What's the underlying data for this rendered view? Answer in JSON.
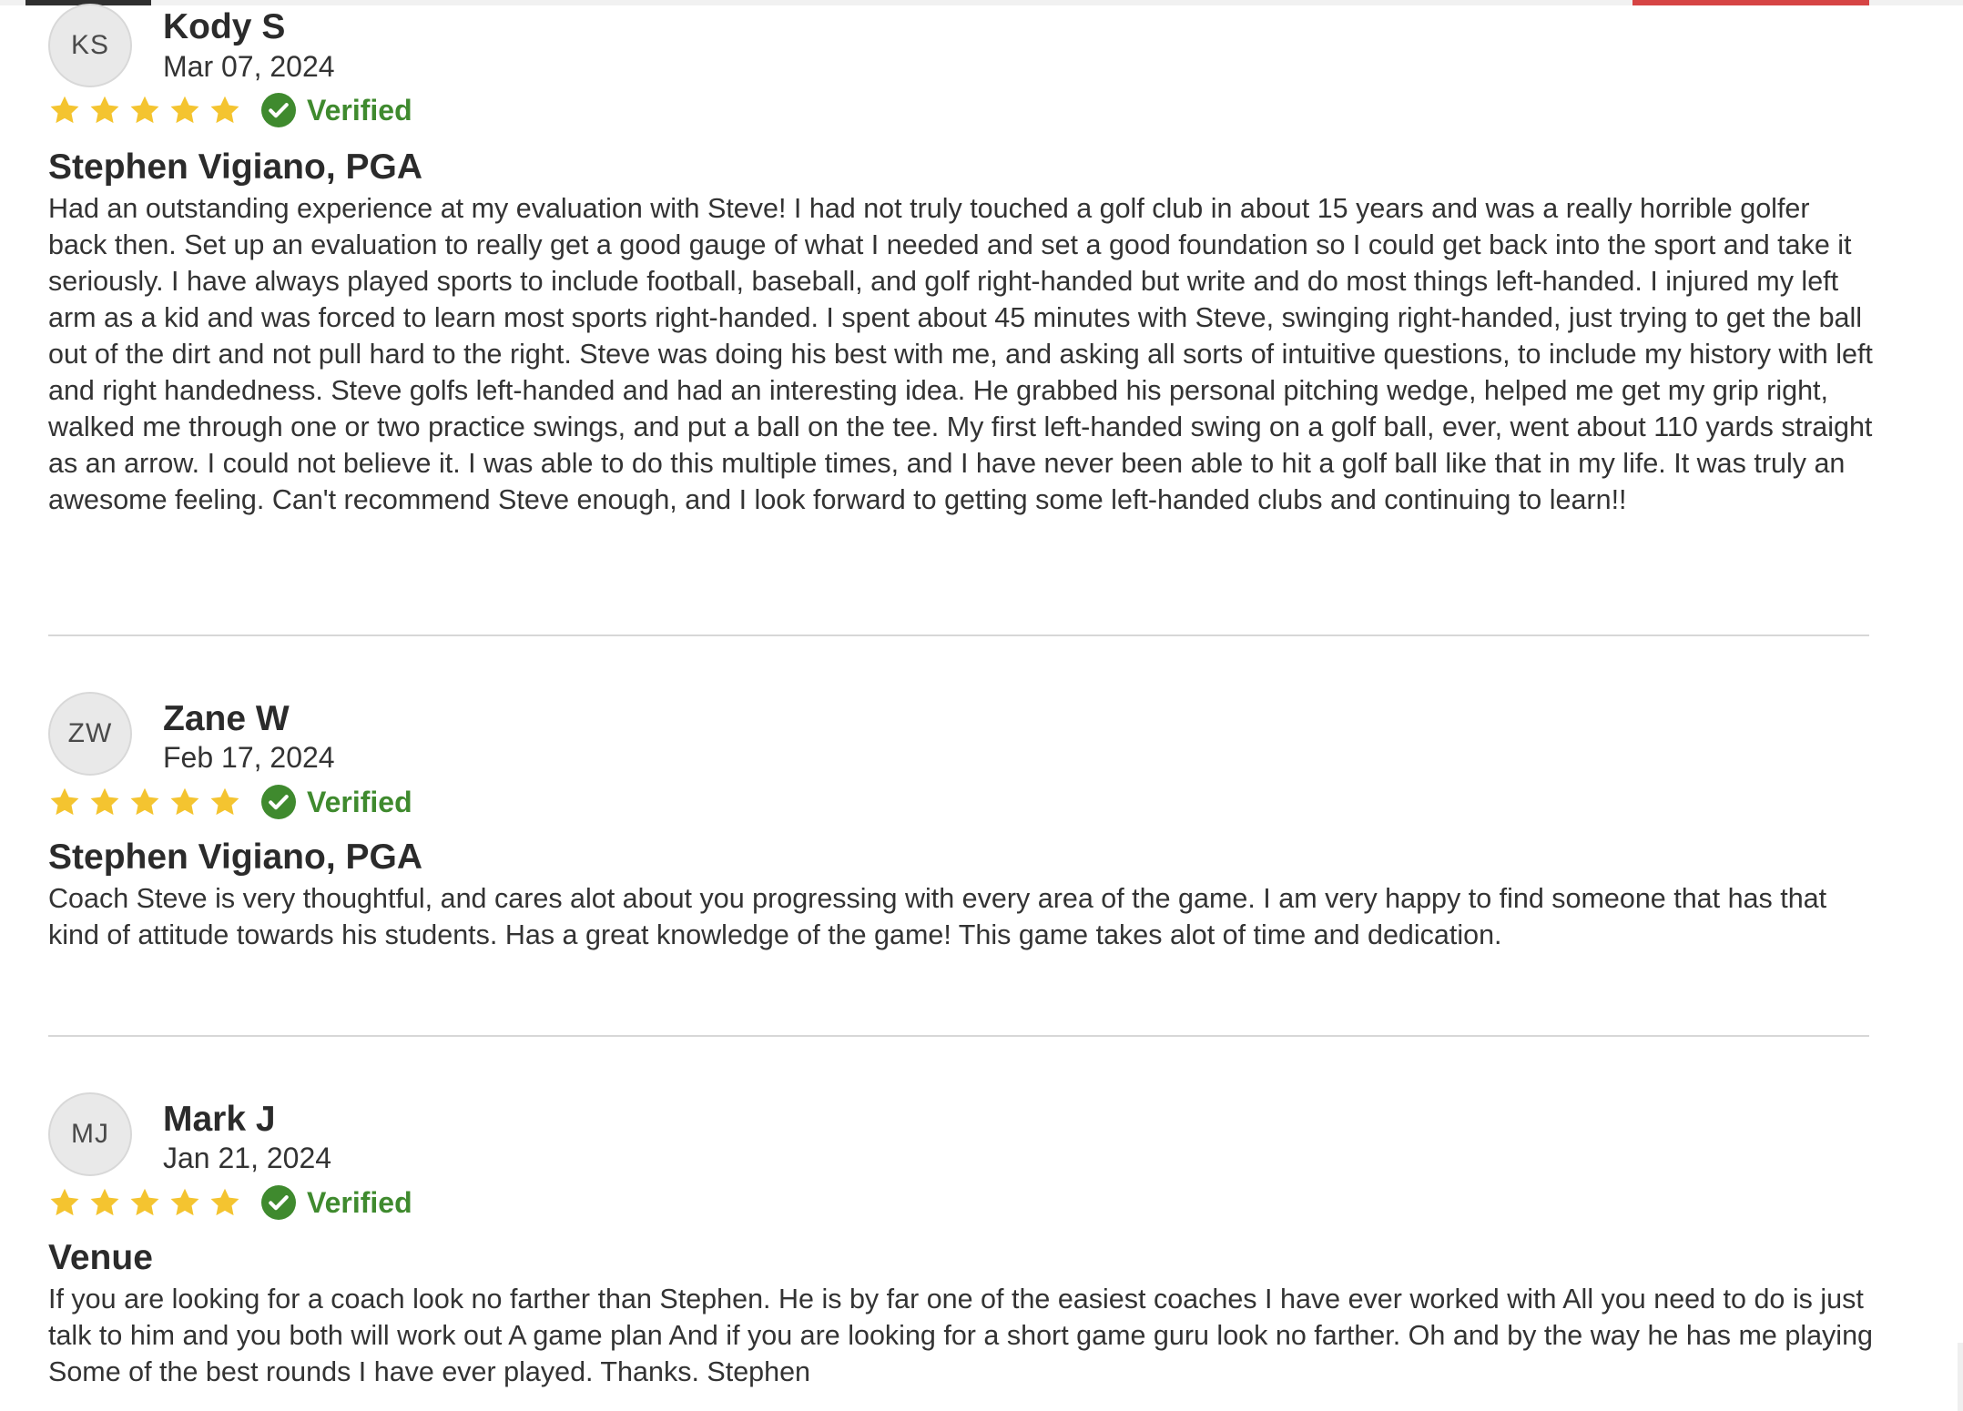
{
  "colors": {
    "star": "#f4c430",
    "verified": "#3f8a2e",
    "accent_red": "#d64444"
  },
  "reviews": [
    {
      "initials": "KS",
      "name": "Kody S",
      "date": "Mar 07, 2024",
      "rating": 5,
      "verified_label": "Verified",
      "title": "Stephen Vigiano, PGA",
      "body": "Had an outstanding experience at my evaluation with Steve! I had not truly touched a golf club in about 15 years and was a really horrible golfer back then. Set up an evaluation to really get a good gauge of what I needed and set a good foundation so I could get back into the sport and take it seriously. I have always played sports to include football, baseball, and golf right-handed but write and do most things left-handed. I injured my left arm as a kid and was forced to learn most sports right-handed. I spent about 45 minutes with Steve, swinging right-handed, just trying to get the ball out of the dirt and not pull hard to the right. Steve was doing his best with me, and asking all sorts of intuitive questions, to include my history with left and right handedness. Steve golfs left-handed and had an interesting idea. He grabbed his personal pitching wedge, helped me get my grip right, walked me through one or two practice swings, and put a ball on the tee. My first left-handed swing on a golf ball, ever, went about 110 yards straight as an arrow. I could not believe it. I was able to do this multiple times, and I have never been able to hit a golf ball like that in my life. It was truly an awesome feeling. Can't recommend Steve enough, and I look forward to getting some left-handed clubs and continuing to learn!!"
    },
    {
      "initials": "ZW",
      "name": "Zane W",
      "date": "Feb 17, 2024",
      "rating": 5,
      "verified_label": "Verified",
      "title": "Stephen Vigiano, PGA",
      "body": "Coach Steve is very thoughtful, and cares alot about you progressing with every area of the game. I am very happy to find someone that has that kind of attitude towards his students. Has a great knowledge of the game! This game takes alot of time and dedication."
    },
    {
      "initials": "MJ",
      "name": "Mark J",
      "date": "Jan 21, 2024",
      "rating": 5,
      "verified_label": "Verified",
      "title": "Venue",
      "body": "If you are looking for a coach look no farther than Stephen. He is by far one of the easiest coaches I have ever worked with All you need to do is just talk to him and you both will work out A game plan And if you are looking for a short game guru look no farther. Oh and by the way he has me playing Some of the best rounds I have ever played. Thanks. Stephen"
    }
  ]
}
